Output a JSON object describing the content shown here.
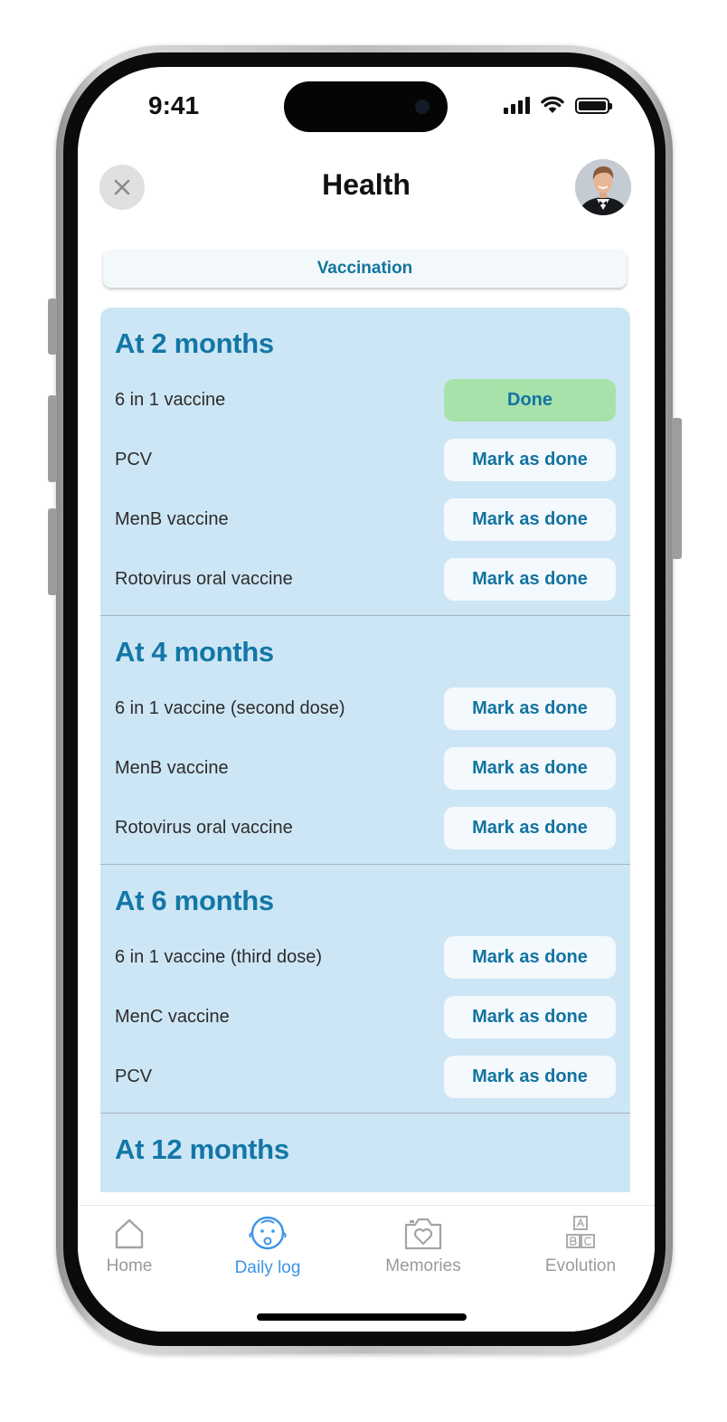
{
  "status_bar": {
    "time": "9:41"
  },
  "header": {
    "title": "Health",
    "close_icon": "close-icon",
    "avatar": "profile-avatar"
  },
  "segment": {
    "label": "Vaccination"
  },
  "sections": [
    {
      "title": "At 2 months",
      "items": [
        {
          "name": "6 in 1 vaccine",
          "action": "Done",
          "done": true
        },
        {
          "name": "PCV",
          "action": "Mark as done",
          "done": false
        },
        {
          "name": "MenB vaccine",
          "action": "Mark as done",
          "done": false
        },
        {
          "name": "Rotovirus oral vaccine",
          "action": "Mark as done",
          "done": false
        }
      ]
    },
    {
      "title": "At 4 months",
      "items": [
        {
          "name": "6 in 1 vaccine (second dose)",
          "action": "Mark as done",
          "done": false
        },
        {
          "name": "MenB vaccine",
          "action": "Mark as done",
          "done": false
        },
        {
          "name": "Rotovirus oral vaccine",
          "action": "Mark as done",
          "done": false
        }
      ]
    },
    {
      "title": "At 6 months",
      "items": [
        {
          "name": "6 in 1 vaccine (third dose)",
          "action": "Mark as done",
          "done": false
        },
        {
          "name": "MenC vaccine",
          "action": "Mark as done",
          "done": false
        },
        {
          "name": "PCV",
          "action": "Mark as done",
          "done": false
        }
      ]
    },
    {
      "title": "At 12 months",
      "items": []
    }
  ],
  "tabbar": {
    "items": [
      {
        "label": "Home",
        "icon": "home-icon",
        "active": false
      },
      {
        "label": "Daily log",
        "icon": "baby-face-icon",
        "active": true
      },
      {
        "label": "Memories",
        "icon": "camera-heart-icon",
        "active": false
      },
      {
        "label": "Evolution",
        "icon": "abc-blocks-icon",
        "active": false
      }
    ]
  },
  "colors": {
    "accent": "#1377a6",
    "panel": "#cde6f5",
    "done": "#a8e2ab",
    "tab_active": "#3d94e6"
  }
}
